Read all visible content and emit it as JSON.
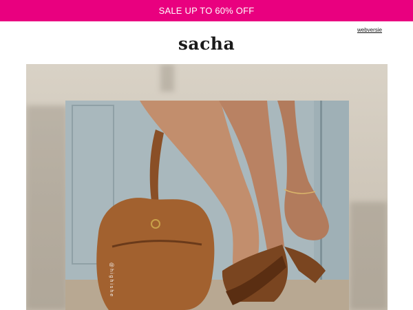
{
  "banner": {
    "text": "SALE UP TO 60% OFF",
    "bg": "#e9007f"
  },
  "header": {
    "web_version_label": "webversie",
    "logo": "sacha"
  },
  "hero": {
    "photo_credit": "@highishe"
  }
}
